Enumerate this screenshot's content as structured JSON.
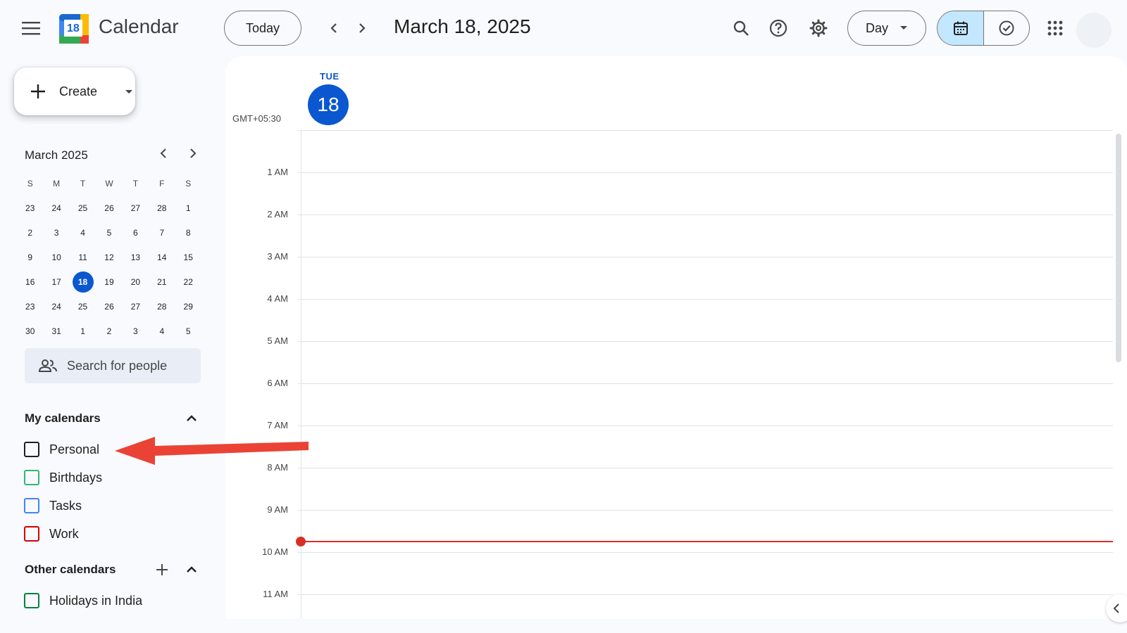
{
  "header": {
    "menu_icon": "hamburger-menu-icon",
    "logo_day": "18",
    "app_title": "Calendar",
    "today_label": "Today",
    "date_title": "March 18, 2025",
    "view_label": "Day",
    "icons": [
      "search-icon",
      "help-icon",
      "gear-icon",
      "chevron-down-icon",
      "calendar-icon",
      "task-check-icon",
      "apps-grid-icon"
    ]
  },
  "sidebar": {
    "create_label": "Create",
    "mini_calendar": {
      "title": "March 2025",
      "weekdays": [
        "S",
        "M",
        "T",
        "W",
        "T",
        "F",
        "S"
      ],
      "weeks": [
        [
          "23",
          "24",
          "25",
          "26",
          "27",
          "28",
          "1"
        ],
        [
          "2",
          "3",
          "4",
          "5",
          "6",
          "7",
          "8"
        ],
        [
          "9",
          "10",
          "11",
          "12",
          "13",
          "14",
          "15"
        ],
        [
          "16",
          "17",
          "18",
          "19",
          "20",
          "21",
          "22"
        ],
        [
          "23",
          "24",
          "25",
          "26",
          "27",
          "28",
          "29"
        ],
        [
          "30",
          "31",
          "1",
          "2",
          "3",
          "4",
          "5"
        ]
      ],
      "today": "18"
    },
    "search_people_placeholder": "Search for people",
    "my_calendars": {
      "title": "My calendars",
      "items": [
        {
          "label": "Personal",
          "color": "#1f1f1f"
        },
        {
          "label": "Birthdays",
          "color": "#33b679"
        },
        {
          "label": "Tasks",
          "color": "#4285f4"
        },
        {
          "label": "Work",
          "color": "#d50000"
        }
      ]
    },
    "other_calendars": {
      "title": "Other calendars",
      "items": [
        {
          "label": "Holidays in India",
          "color": "#0b8043"
        }
      ]
    }
  },
  "day_view": {
    "day_of_week": "TUE",
    "day_number": "18",
    "timezone": "GMT+05:30",
    "hours": [
      "1 AM",
      "2 AM",
      "3 AM",
      "4 AM",
      "5 AM",
      "6 AM",
      "7 AM",
      "8 AM",
      "9 AM",
      "10 AM",
      "11 AM"
    ],
    "current_time_color": "#d93025"
  },
  "annotation": {
    "arrow_color": "#ea4335",
    "points_to": "Personal"
  },
  "colors": {
    "accent": "#0b57d0",
    "selected_segment": "#c2e7ff",
    "background": "#f8fafd"
  }
}
